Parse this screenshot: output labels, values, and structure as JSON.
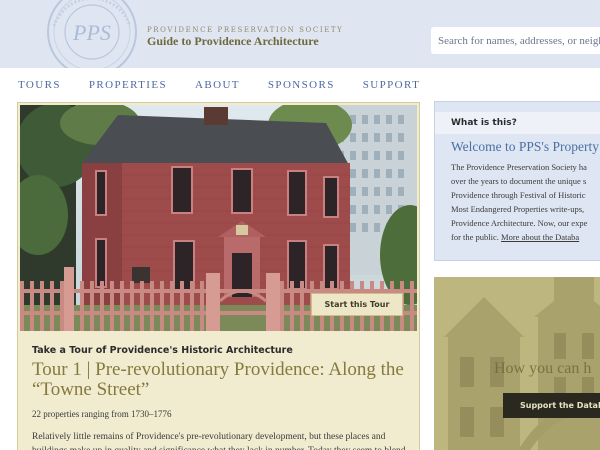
{
  "header": {
    "seal_text": "PPS",
    "org_name": "Providence Preservation Society",
    "site_title": "Guide to Providence Architecture",
    "search_placeholder": "Search for names, addresses, or neighborhoods"
  },
  "nav": {
    "items": [
      {
        "label": "Tours"
      },
      {
        "label": "Properties"
      },
      {
        "label": "About"
      },
      {
        "label": "Sponsors"
      },
      {
        "label": "Support"
      }
    ]
  },
  "tour": {
    "button_label": "Start this Tour",
    "kicker": "Take a Tour of Providence's Historic Architecture",
    "title": "Tour 1 | Pre-revolutionary Providence: Along the “Towne Street”",
    "count": "22 properties ranging from 1730–1776",
    "body": "Relatively little remains of Providence's pre-revolutionary development, but these places and buildings make up in quality and significance what they lack in number. Today they seem to blend"
  },
  "info": {
    "heading": "What is this?",
    "title": "Welcome to PPS's Property D",
    "lines": [
      "The Providence Preservation Society ha",
      "over the years to document the unique s",
      "Providence through Festival of Historic",
      "Most Endangered Properties write-ups,",
      "Providence Architecture. Now, our expe"
    ],
    "last_line": "for the public.",
    "link": "More about the Databa"
  },
  "support": {
    "heading": "How you can h",
    "button_label": "Support the Databa"
  },
  "colors": {
    "header_bg": "#dfe6f1",
    "nav_link": "#4d6aa0",
    "tour_card_bg": "#f1ebd0",
    "tour_title": "#86793d",
    "info_card_bg": "#dfe6f3",
    "info_title": "#4a6fa3",
    "support_bg": "#b9b27c",
    "support_button": "#2a2920"
  },
  "icons": {
    "seal": "preservation-society-seal",
    "tour_photo": "red-colonial-house-photo",
    "support_photo": "victorian-house-photo"
  }
}
